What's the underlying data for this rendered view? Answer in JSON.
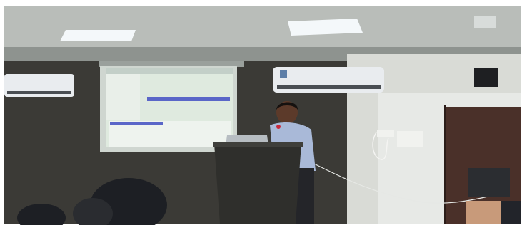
{
  "scene": {
    "colors": {
      "ceiling": "#b9bdb9",
      "ceiling_dark": "#8e938f",
      "light_panel": "#f4f8fa",
      "wall_dark": "#3b3a36",
      "wall_right": "#d9dbd6",
      "right_panel": "#e7e9e6",
      "screen_frame": "#cfd6d0",
      "screen_bg": "#dfeadf",
      "screen_highlight": "#5a66c8",
      "podium": "#2f2f2c",
      "shirt": "#a9b9d8",
      "door": "#4a3029",
      "ac_unit": "#e9ecef",
      "speaker": "#1e1f22",
      "audience": "#1d1f24"
    }
  }
}
